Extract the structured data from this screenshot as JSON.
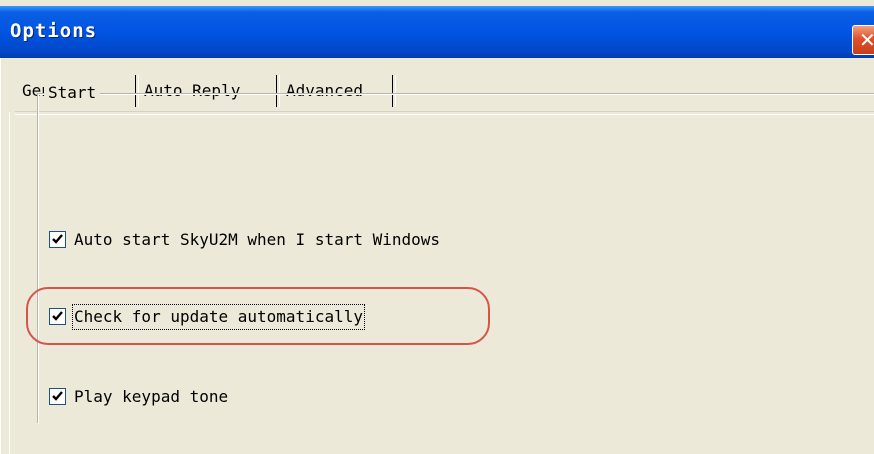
{
  "window": {
    "title": "Options",
    "close_glyph": "✕"
  },
  "tabs": [
    {
      "label": "General",
      "selected": true
    },
    {
      "label": "Auto Reply",
      "selected": false
    },
    {
      "label": "Advanced",
      "selected": false
    }
  ],
  "group": {
    "title": "Start",
    "options": [
      {
        "label": "Auto start SkyU2M when I start Windows",
        "checked": true
      },
      {
        "label": "Check for update automatically",
        "checked": true,
        "focused": true,
        "highlighted": true
      },
      {
        "label": "Play keypad tone",
        "checked": true
      }
    ]
  },
  "colors": {
    "titlebar": "#0054e3",
    "dialog_background": "#ece9d8",
    "close_button": "#e0512a",
    "highlight_ring": "#d8534a"
  },
  "icons": {
    "close": "close-icon",
    "check": "check-icon"
  }
}
